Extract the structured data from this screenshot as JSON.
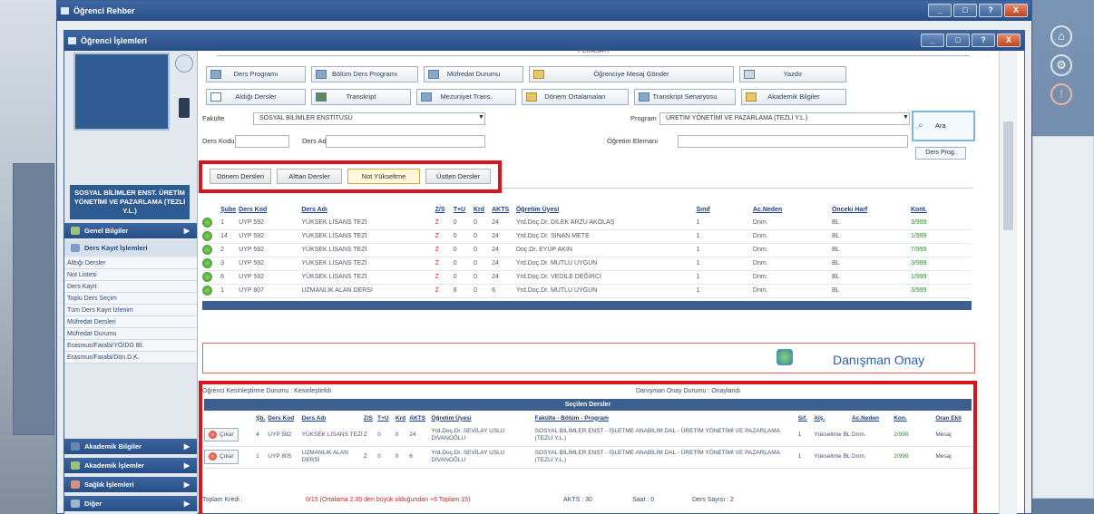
{
  "outer_window": {
    "title": "Öğrenci Rehber"
  },
  "inner_window": {
    "title": "Öğrenci İşlemleri"
  },
  "window_buttons": [
    "_",
    "□",
    "?",
    "X"
  ],
  "header_fragment": "PERASATI",
  "left_menu": {
    "program_title": "SOSYAL BİLİMLER ENST. ÜRETİM YÖNETİMİ VE PAZARLAMA (TEZLİ Y.L.)",
    "sections": [
      {
        "label": "Genel Bilgiler"
      },
      {
        "label": "Ders Kayıt İşlemleri"
      }
    ],
    "items": [
      "Alttığı Dersler",
      "Not Listesi",
      "Ders Kayıt",
      "Toplu Ders Seçim",
      "Tüm Ders Kayıt İzlenim",
      "Müfredat Dersleri",
      "Müfredat Durumu",
      "Erasmus/Farabi/YÖ/DG Bİ.",
      "Erasmus/Farabi/Dön.D.K."
    ],
    "bottom_sections": [
      {
        "label": "Akademik Bilgiler"
      },
      {
        "label": "Akademik İşlemler"
      },
      {
        "label": "Sağlık İşlemleri"
      },
      {
        "label": "Diğer"
      }
    ]
  },
  "toolbar": {
    "row1": [
      "Ders Programı",
      "Bölüm Ders Programı",
      "Müfredat Durumu",
      "Öğrenciye Mesaj Gönder",
      "Yazdır"
    ],
    "row2": [
      "Aldığı Dersler",
      "Transkript",
      "Mezuniyet Trans.",
      "Dönem Ortalamaları",
      "Transkript Senaryosu",
      "Akademik Bilgiler"
    ]
  },
  "filters": {
    "fakulte_label": "Fakülte",
    "fakulte_value": "SOSYAL BİLİMLER ENSTİTÜSÜ",
    "program_label": "Program",
    "program_value": "ÜRETİM YÖNETİMİ VE PAZARLAMA (TEZLİ Y.L.)",
    "ders_kodu_label": "Ders Kodu",
    "ders_adi_label": "Ders Adı",
    "ogretim_label": "Öğretim Elemanı",
    "ara_label": "Ara",
    "ders_prog_label": "Ders Prog."
  },
  "tabs": [
    {
      "label": "Dönem Dersleri",
      "active": false
    },
    {
      "label": "Alttan Dersler",
      "active": false
    },
    {
      "label": "Not Yükseltme",
      "active": true
    },
    {
      "label": "Üstten Dersler",
      "active": false
    }
  ],
  "course_table": {
    "headers": [
      "Şube",
      "Ders Kod",
      "Ders Adı",
      "Z/S",
      "T+U",
      "Krd",
      "AKTS",
      "Öğretim Üyesi",
      "Sınıf",
      "Ac.Neden",
      "Önceki Harf",
      "Kont."
    ],
    "rows": [
      [
        "1",
        "UYP 592",
        "YÜKSEK LİSANS TEZİ",
        "Z",
        "0",
        "0",
        "24",
        "Yrd.Doç.Dr. DİLEK ARZU AKOLAŞ",
        "1",
        "Dnm.",
        "BL",
        "3/999"
      ],
      [
        "14",
        "UYP 592",
        "YÜKSEK LİSANS TEZİ",
        "Z",
        "0",
        "0",
        "24",
        "Yrd.Doç.Dr. SİNAN METE",
        "1",
        "Dnm.",
        "BL",
        "1/999"
      ],
      [
        "2",
        "UYP 592",
        "YÜKSEK LİSANS TEZİ",
        "Z",
        "0",
        "0",
        "24",
        "Doç.Dr. EYÜP AKIN",
        "1",
        "Dnm.",
        "BL",
        "7/999"
      ],
      [
        "3",
        "UYP 592",
        "YÜKSEK LİSANS TEZİ",
        "Z",
        "0",
        "0",
        "24",
        "Yrd.Doç.Dr. MUTLU UYGUN",
        "1",
        "Dnm.",
        "BL",
        "3/999"
      ],
      [
        "6",
        "UYP 592",
        "YÜKSEK LİSANS TEZİ",
        "Z",
        "0",
        "0",
        "24",
        "Yrd.Doç.Dr. VEDİLE DEĞİRCİ",
        "1",
        "Dnm.",
        "BL",
        "1/999"
      ],
      [
        "1",
        "UYP 807",
        "UZMANLIK ALAN DERSİ",
        "Z",
        "8",
        "0",
        "6",
        "Yrd.Doç.Dr. MUTLU UYGUN",
        "1",
        "Dnm.",
        "BL",
        "3/999"
      ]
    ]
  },
  "advisor": {
    "label": "Danışman Onay",
    "status_left": "Öğrenci Kesinleştirme Durumu : Kesinleştirildi",
    "status_right": "Danışman Onay Durumu : Onaylandı",
    "selected_header": "Seçilen Dersler"
  },
  "selected_table": {
    "headers": [
      "Şb.",
      "Ders Kod",
      "Ders Adı",
      "Z/S",
      "T+U",
      "Krd",
      "AKTS",
      "Öğretim Üyesi",
      "Fakülte - Bölüm - Program",
      "Sıf.",
      "Alş.",
      "Ac.Neden",
      "Kon.",
      "Oran Ekli"
    ],
    "remove_label": "Çıkar",
    "rows": [
      [
        "4",
        "UYP 592",
        "YÜKSEK LİSANS TEZİ",
        "Z",
        "0",
        "0",
        "24",
        "Yrd.Doç.Dr. SEVİLAY USLU DİVANOĞLU",
        "SOSYAL BİLİMLER ENST - İŞLETME ANABİLİM DAL - ÜRETİM YÖNETİMİ VE PAZARLAMA (TEZLİ Y.L.)",
        "1",
        "Yükseltme BL",
        "Dnm.",
        "2/999",
        "Mesaj"
      ],
      [
        "1",
        "UYP 805",
        "UZMANLIK ALAN DERSİ",
        "Z",
        "0",
        "0",
        "6",
        "Yrd.Doç.Dr. SEVİLAY USLU DİVANOĞLU",
        "SOSYAL BİLİMLER ENST - İŞLETME ANABİLİM DAL - ÜRETİM YÖNETİMİ VE PAZARLAMA (TEZLİ Y.L.)",
        "1",
        "Yükseltme BL",
        "Dnm.",
        "2/999",
        "Mesaj"
      ]
    ]
  },
  "footer": {
    "toplam_kredi_label": "Toplam Kredi :",
    "toplam_kredi_value": "0/15 (Ortalama 2.00 den büyük olduğundan +6 Toplam:15)",
    "akts": "AKTS : 30",
    "saat": "Saat : 0",
    "ders_sayisi": "Ders Sayısı : 2"
  },
  "colors": {
    "title_blue": "#2a4f86",
    "highlight_red": "#d8141c",
    "link_blue": "#1b3f8a"
  },
  "icons": [
    "home-icon",
    "settings-icon",
    "alert-icon",
    "checkmark-icon",
    "remove-icon"
  ]
}
